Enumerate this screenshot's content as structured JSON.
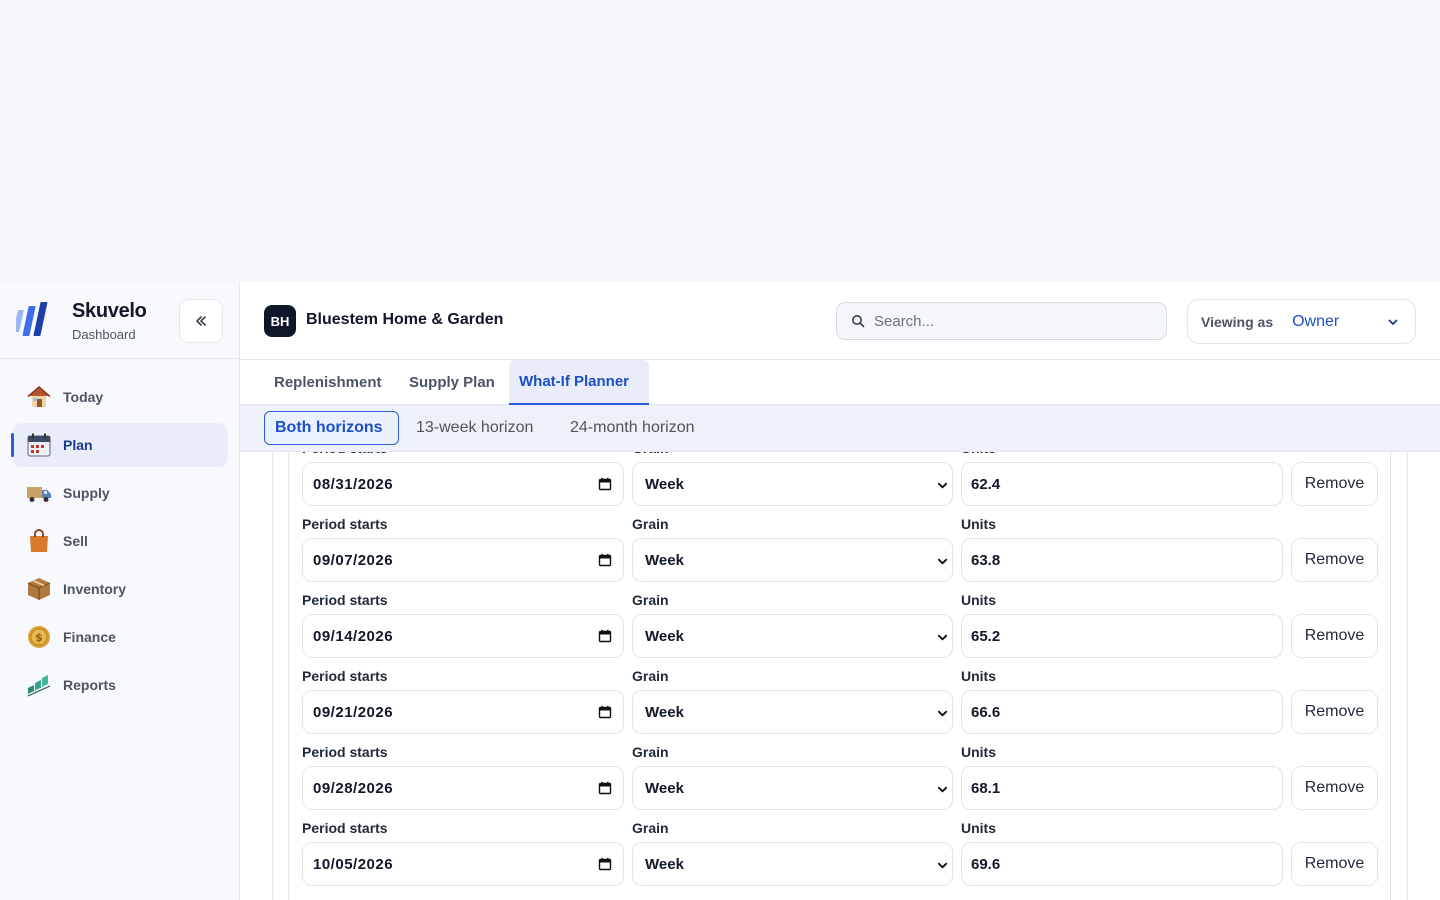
{
  "brand": {
    "name": "Skuvelo",
    "subtitle": "Dashboard"
  },
  "sidebar": {
    "collapse_icon": "double-chevron-left-icon",
    "items": [
      {
        "label": "Today",
        "icon": "house-icon",
        "active": false
      },
      {
        "label": "Plan",
        "icon": "calendar-icon",
        "active": true
      },
      {
        "label": "Supply",
        "icon": "truck-icon",
        "active": false
      },
      {
        "label": "Sell",
        "icon": "shopping-bag-icon",
        "active": false
      },
      {
        "label": "Inventory",
        "icon": "package-icon",
        "active": false
      },
      {
        "label": "Finance",
        "icon": "coin-icon",
        "active": false
      },
      {
        "label": "Reports",
        "icon": "bar-chart-icon",
        "active": false
      }
    ]
  },
  "header": {
    "org_initials": "BH",
    "org_name": "Bluestem Home & Garden",
    "search_placeholder": "Search...",
    "viewing_label": "Viewing as",
    "viewing_value": "Owner"
  },
  "tabs": [
    {
      "label": "Replenishment",
      "active": false
    },
    {
      "label": "Supply Plan",
      "active": false
    },
    {
      "label": "What-If Planner",
      "active": true
    }
  ],
  "subtabs": [
    {
      "label": "Both horizons",
      "active": true
    },
    {
      "label": "13-week horizon",
      "active": false
    },
    {
      "label": "24-month horizon",
      "active": false
    }
  ],
  "form_labels": {
    "period": "Period starts",
    "grain": "Grain",
    "units": "Units",
    "remove": "Remove"
  },
  "rows": [
    {
      "period": "08/31/2026",
      "grain": "Week",
      "units": "62.4"
    },
    {
      "period": "09/07/2026",
      "grain": "Week",
      "units": "63.8"
    },
    {
      "period": "09/14/2026",
      "grain": "Week",
      "units": "65.2"
    },
    {
      "period": "09/21/2026",
      "grain": "Week",
      "units": "66.6"
    },
    {
      "period": "09/28/2026",
      "grain": "Week",
      "units": "68.1"
    },
    {
      "period": "10/05/2026",
      "grain": "Week",
      "units": "69.6"
    }
  ],
  "colors": {
    "accent": "#2e5bd8",
    "active_bg": "#e8edf9",
    "page_bg": "#f4f6fb"
  }
}
